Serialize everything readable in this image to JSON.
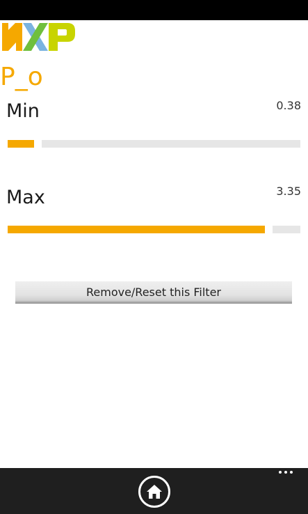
{
  "brand": {
    "logo_text": "NXP",
    "colors": {
      "n": "#f5a800",
      "x_left": "#7ab3e0",
      "x_right": "#6fbf3d",
      "p": "#c8d400"
    }
  },
  "page": {
    "title": "P_o",
    "title_color": "#f5a800"
  },
  "filters": {
    "min": {
      "label": "Min",
      "value": "0.38",
      "level": 0.09
    },
    "max": {
      "label": "Max",
      "value": "3.35",
      "level": 0.88
    }
  },
  "accent_color": "#f5a800",
  "actions": {
    "reset_label": "Remove/Reset this Filter"
  },
  "app_bar": {
    "home_icon": "home-icon",
    "more_icon": "more-icon"
  }
}
